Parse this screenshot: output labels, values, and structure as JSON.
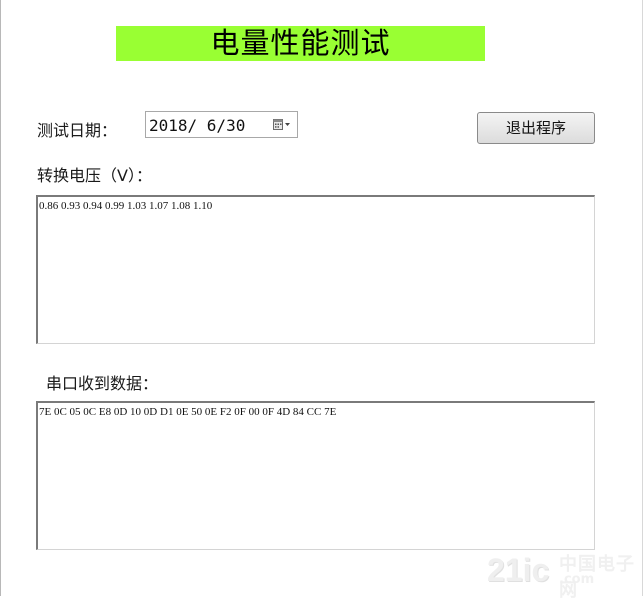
{
  "header": {
    "title": "电量性能测试",
    "title_bg_color": "#99ff33"
  },
  "date": {
    "label": "测试日期：",
    "value": "2018/ 6/30",
    "icon": "calendar-dropdown-icon"
  },
  "exit_button": {
    "label": "退出程序"
  },
  "voltage": {
    "label": "转换电压（V）：",
    "content": "0.86 0.93 0.94 0.99 1.03 1.07 1.08 1.10"
  },
  "serial": {
    "label": "串口收到数据：",
    "content": "7E 0C 05 0C E8 0D 10 0D D1 0E 50 0E F2 0F 00 0F 4D 84 CC 7E"
  },
  "watermark": {
    "main": "21ic",
    "line1": "中国电子网",
    "line2": ".com"
  }
}
